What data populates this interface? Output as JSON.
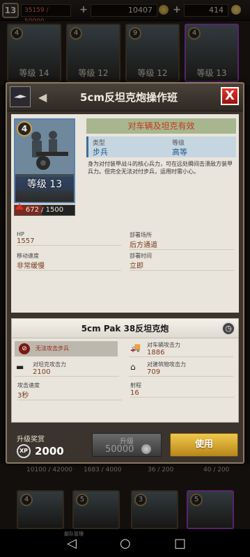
{
  "topbar": {
    "level": "13",
    "resource1": "35159 / 50000",
    "resource2": "10407",
    "resource3": "414"
  },
  "background": {
    "top_cards": [
      {
        "level": "4",
        "label": "等级 14"
      },
      {
        "level": "4",
        "label": "等级 12"
      },
      {
        "level": "9",
        "label": "等级 12"
      },
      {
        "level": "4",
        "label": "等级 13"
      }
    ],
    "middle_texts": [
      "10100 / 42000",
      "1683 / 4000",
      "36 / 200",
      "40 / 200"
    ],
    "bottom_cards": [
      {
        "level": "4"
      },
      {
        "level": "5"
      },
      {
        "level": "3"
      },
      {
        "level": "5"
      }
    ],
    "nav_label": "部队管理"
  },
  "modal": {
    "title": "5cm反坦克炮操作班",
    "close_label": "X",
    "back_label": "◀",
    "effect": "对车辆及坦克有效",
    "unit_level": "4",
    "unit_level_label": "等级 13",
    "xp_text": "672 / 1500",
    "xp_progress": 0.448,
    "type_key": "类型",
    "type_value": "步兵",
    "grade_key": "等级",
    "grade_value": "高等",
    "description": "身为对付装甲战斗的核心兵力，可在远处瞬间击溃敌方装甲兵力。但完全无法对付步兵，运用时需小心。",
    "stats": [
      {
        "key": "HP",
        "value": "1557"
      },
      {
        "key": "部署场所",
        "value": "后方通道"
      },
      {
        "key": "移动速度",
        "value": "非常缓慢"
      },
      {
        "key": "部署时间",
        "value": "立即"
      }
    ],
    "weapon": {
      "title": "5cm Pak 38反坦克炮",
      "no_attack": "无法攻击步兵",
      "vehicle_key": "对车辆攻击力",
      "vehicle_value": "1886",
      "tank_key": "对坦克攻击力",
      "tank_value": "2100",
      "building_key": "对建筑物攻击力",
      "building_value": "709",
      "speed_key": "攻击速度",
      "speed_value": "3秒",
      "range_key": "射程",
      "range_value": "16"
    },
    "footer": {
      "reward_label": "升级奖赏",
      "xp_icon": "XP",
      "reward_value": "2000",
      "upgrade_label": "升级",
      "upgrade_cost": "50000",
      "use_label": "使用"
    }
  }
}
